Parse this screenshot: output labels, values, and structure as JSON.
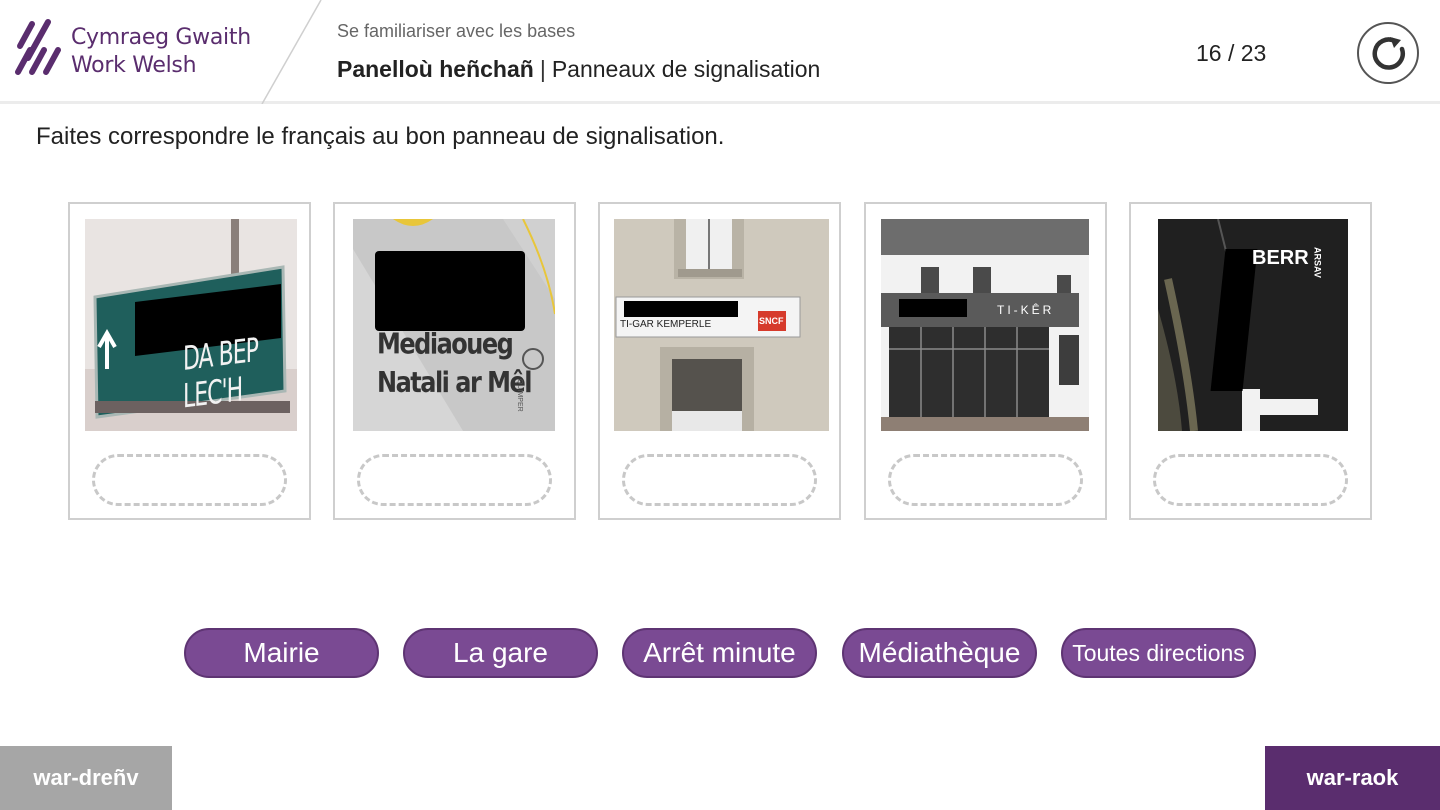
{
  "header": {
    "logo_line1": "Cymraeg Gwaith",
    "logo_line2": "Work Welsh",
    "breadcrumb": "Se familiariser avec les bases",
    "title_bold": "Panelloù heñchañ",
    "title_separator": "|",
    "title_rest": "Panneaux de signalisation",
    "progress": "16 / 23",
    "reset_icon": "refresh-icon"
  },
  "instruction": "Faites correspondre le français au bon panneau de signalisation.",
  "cards": [
    {
      "sign_text": "DA BEP LEC'H",
      "photo": "street-direction-sign"
    },
    {
      "sign_text_line1": "Mediaoueg",
      "sign_text_line2": "Natali ar Mêl",
      "brand": "QUIMPER",
      "photo": "library-wall-sign"
    },
    {
      "sign_text": "TI-GAR KEMPERLE",
      "brand": "SNCF",
      "photo": "train-station-facade"
    },
    {
      "sign_text": "TI-KÊR",
      "photo": "town-hall-building"
    },
    {
      "sign_text_line1": "ARSAV",
      "sign_text_line2": "BERR",
      "photo": "road-marking"
    }
  ],
  "answers": [
    "Mairie",
    "La gare",
    "Arrêt minute",
    "Médiathèque",
    "Toutes directions"
  ],
  "footer": {
    "prev_label": "war-dreñv",
    "next_label": "war-raok"
  },
  "colors": {
    "brand_purple": "#5a2d6e",
    "chip_purple": "#7a4a93",
    "prev_gray": "#a6a6a6"
  }
}
